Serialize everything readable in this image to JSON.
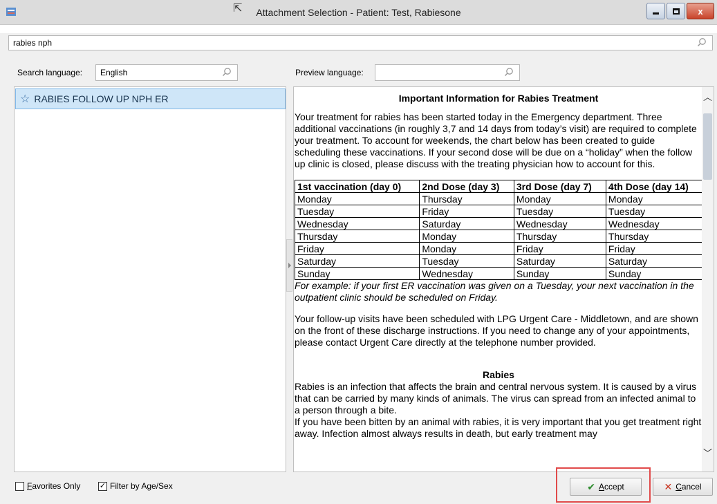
{
  "window": {
    "title": "Attachment Selection - Patient: Test, Rabiesone",
    "close_glyph": "x"
  },
  "search": {
    "value": "rabies nph"
  },
  "search_language": {
    "label": "Search language:",
    "value": "English"
  },
  "preview_language": {
    "label": "Preview language:",
    "value": ""
  },
  "list": {
    "items": [
      {
        "label": "RABIES FOLLOW UP NPH ER",
        "icon": "star-icon"
      }
    ]
  },
  "document": {
    "title": "Important Information for Rabies Treatment",
    "intro": "Your treatment for rabies has been started today in the Emergency department.  Three additional vaccinations (in roughly 3,7 and 14 days from today’s visit) are required to complete your treatment.  To account for weekends, the chart below has been created to guide scheduling these vaccinations.  If your second dose will be due on a “holiday” when the follow up clinic is closed, please discuss with the treating physician how to account for this.",
    "table_headers": [
      "1st vaccination (day 0)",
      "2nd Dose (day 3)",
      "3rd Dose (day 7)",
      "4th Dose (day 14)"
    ],
    "table_rows": [
      [
        "Monday",
        "Thursday",
        "Monday",
        "Monday"
      ],
      [
        "Tuesday",
        "Friday",
        "Tuesday",
        "Tuesday"
      ],
      [
        "Wednesday",
        "Saturday",
        "Wednesday",
        "Wednesday"
      ],
      [
        "Thursday",
        "Monday",
        "Thursday",
        "Thursday"
      ],
      [
        "Friday",
        "Monday",
        "Friday",
        "Friday"
      ],
      [
        "Saturday",
        "Tuesday",
        "Saturday",
        "Saturday"
      ],
      [
        "Sunday",
        "Wednesday",
        "Sunday",
        "Sunday"
      ]
    ],
    "example": "For example: if your first ER vaccination was given on a Tuesday, your next vaccination in the outpatient clinic should be scheduled on Friday.",
    "followup": "Your follow-up visits have been scheduled with LPG Urgent Care - Middletown, and are shown on the front of these discharge instructions.  If you need to change any of your appointments, please contact Urgent Care directly at the telephone number provided.",
    "rabies_title": "Rabies",
    "rabies_p1": "Rabies is an infection that affects the brain and central nervous system. It is caused by a virus that can be carried by many kinds of animals. The virus can spread from an infected animal to a person through a bite.",
    "rabies_p2": "If you have been bitten by an animal with rabies, it is very important that you get treatment right away. Infection almost always results in death, but early treatment may"
  },
  "footer": {
    "favorites_first": "F",
    "favorites_rest": "avorites Only",
    "favorites_checked": false,
    "filter_label": "Filter by Age/Sex",
    "filter_checked": true,
    "accept_first": "A",
    "accept_rest": "ccept",
    "cancel_first": "C",
    "cancel_rest": "ancel"
  },
  "colors": {
    "highlight": "#e14a4a",
    "selection": "#cfe6f8",
    "accept_icon": "#2a8a2a",
    "cancel_icon": "#c8321e"
  }
}
